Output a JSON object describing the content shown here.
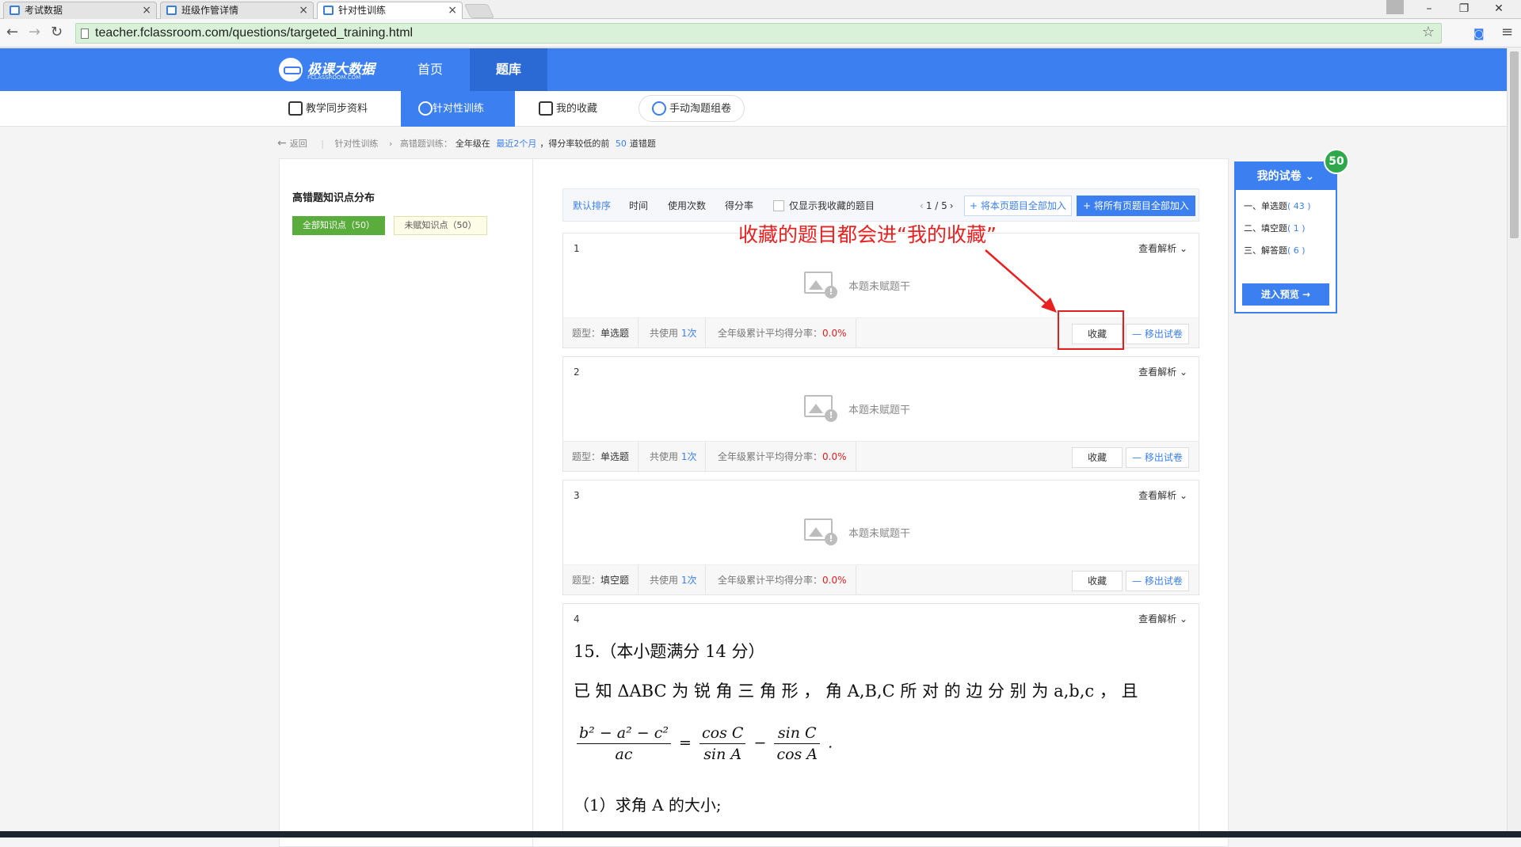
{
  "browser": {
    "tabs": [
      {
        "label": "考试数据"
      },
      {
        "label": "班级作管详情"
      },
      {
        "label": "针对性训练"
      }
    ],
    "url": "teacher.fclassroom.com/questions/targeted_training.html",
    "window_controls": {
      "minimize": "–",
      "restore": "❐",
      "close": "✕"
    },
    "nav": {
      "back": "←",
      "forward": "→",
      "reload": "↻"
    }
  },
  "header": {
    "logo_name": "极课大数据",
    "logo_sub": "FCLASSROOM.COM",
    "nav": [
      {
        "label": "首页"
      },
      {
        "label": "题库"
      }
    ]
  },
  "subnav": [
    {
      "label": "教学同步资料"
    },
    {
      "label": "针对性训练"
    },
    {
      "label": "我的收藏"
    },
    {
      "label": "手动淘题组卷"
    }
  ],
  "breadcrumb": {
    "back": "返回",
    "crumb1": "针对性训练",
    "crumb2": "高错题训练：",
    "desc_a": "全年级在",
    "desc_range": "最近2个月",
    "desc_b": "，得分率较低的前",
    "desc_count": "50",
    "desc_c": "道错题"
  },
  "left_panel": {
    "title": "高错题知识点分布",
    "filter_all": "全部知识点（50）",
    "filter_untagged": "未赋知识点（50）"
  },
  "toolbar": {
    "sort_default": "默认排序",
    "sort_time": "时间",
    "sort_usage": "使用次数",
    "sort_score": "得分率",
    "only_fav": "仅显示我收藏的题目",
    "page_current": "1",
    "page_sep": " / ",
    "page_total": "5",
    "add_page": "+ 将本页题目全部加入",
    "add_all": "+ 将所有页题目全部加入"
  },
  "questions": [
    {
      "num": "1",
      "expand": "查看解析 ⌄",
      "empty_text": "本题未赋题干",
      "type_label": "题型：",
      "type_value": "单选题",
      "use_label": "共使用",
      "use_value": "1次",
      "score_label": "全年级累计平均得分率：",
      "score_value": "0.0%",
      "fav_label": "收藏",
      "remove_label": "— 移出试卷"
    },
    {
      "num": "2",
      "expand": "查看解析 ⌄",
      "empty_text": "本题未赋题干",
      "type_label": "题型：",
      "type_value": "单选题",
      "use_label": "共使用",
      "use_value": "1次",
      "score_label": "全年级累计平均得分率：",
      "score_value": "0.0%",
      "fav_label": "收藏",
      "remove_label": "— 移出试卷"
    },
    {
      "num": "3",
      "expand": "查看解析 ⌄",
      "empty_text": "本题未赋题干",
      "type_label": "题型：",
      "type_value": "填空题",
      "use_label": "共使用",
      "use_value": "1次",
      "score_label": "全年级累计平均得分率：",
      "score_value": "0.0%",
      "fav_label": "收藏",
      "remove_label": "— 移出试卷"
    },
    {
      "num": "4",
      "expand": "查看解析 ⌄",
      "heading": "15.（本小题满分 14 分）",
      "line1": "已 知 ΔABC 为 锐 角 三 角 形 ， 角 A,B,C 所 对 的 边 分 别 为 a,b,c ， 且",
      "frac1_num": "b² − a² − c²",
      "frac1_den": "ac",
      "eq": "=",
      "frac2_num": "cos C",
      "frac2_den": "sin A",
      "minus": "−",
      "frac3_num": "sin C",
      "frac3_den": "cos A",
      "period": ".",
      "part1": "（1）求角 A 的大小;"
    }
  ],
  "annotation": {
    "text": "收藏的题目都会进“我的收藏”",
    "color": "#e82020"
  },
  "my_paper": {
    "title": "我的试卷 ⌄",
    "badge": "50",
    "rows": [
      {
        "label": "一、单选题",
        "count": "( 43 )"
      },
      {
        "label": "二、填空题",
        "count": "( 1 )"
      },
      {
        "label": "三、解答题",
        "count": "( 6 )"
      }
    ],
    "preview": "进入预览 →"
  },
  "colors": {
    "brand_blue": "#3b7ff0",
    "green": "#5aad3c",
    "red": "#e02020"
  }
}
